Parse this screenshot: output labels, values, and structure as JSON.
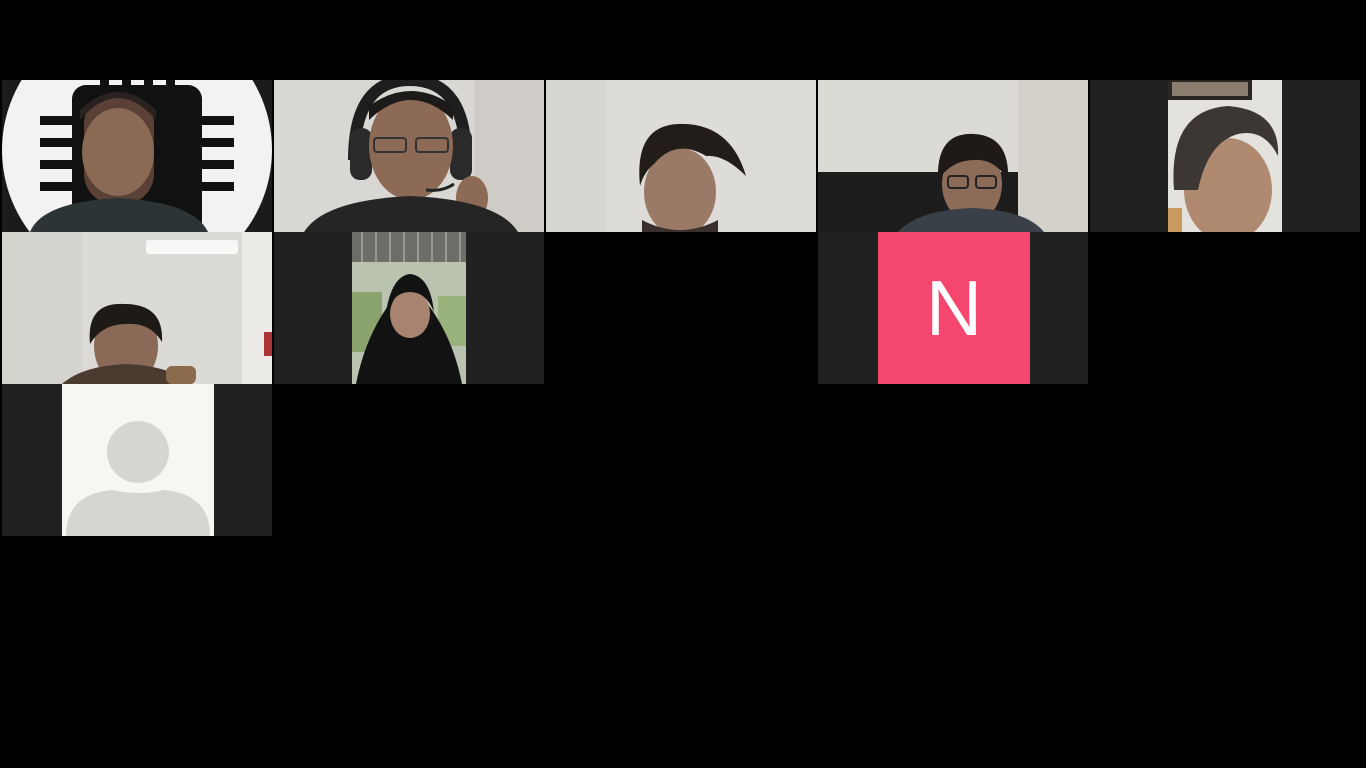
{
  "meeting": {
    "view": "gallery",
    "participants": [
      {
        "id": 1,
        "type": "video",
        "background": "chip-logo"
      },
      {
        "id": 2,
        "type": "video",
        "background": "wall",
        "accessory": "headset"
      },
      {
        "id": 3,
        "type": "video",
        "background": "wall"
      },
      {
        "id": 4,
        "type": "video",
        "background": "wall-sofa"
      },
      {
        "id": 5,
        "type": "video",
        "background": "wall",
        "orientation": "portrait"
      },
      {
        "id": 6,
        "type": "video",
        "background": "room-light"
      },
      {
        "id": 7,
        "type": "video",
        "background": "outdoor",
        "orientation": "portrait"
      },
      {
        "id": 8,
        "type": "video",
        "video_off": true
      },
      {
        "id": 9,
        "type": "initial",
        "initial": "N",
        "color": "#f4466f"
      },
      {
        "id": 10,
        "type": "video",
        "video_off": true
      },
      {
        "id": 11,
        "type": "avatar",
        "icon": "default-avatar-icon"
      }
    ]
  }
}
